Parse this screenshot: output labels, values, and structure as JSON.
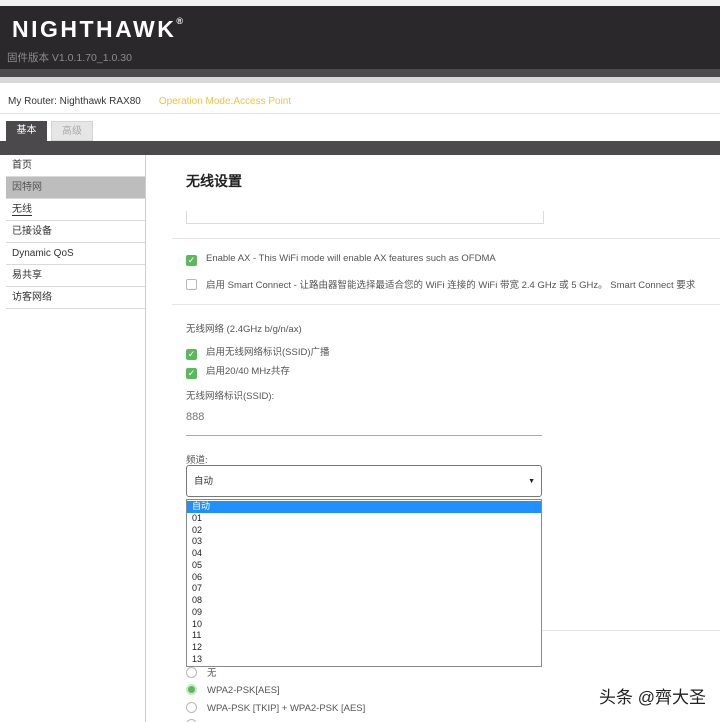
{
  "header": {
    "logo": "NIGHTHAWK",
    "logo_mark": "®",
    "firmware": "固件版本 V1.0.1.70_1.0.30"
  },
  "router_info": {
    "name": "My Router: Nighthawk RAX80",
    "mode": "Operation Mode:Access Point"
  },
  "tabs": [
    {
      "label": "基本",
      "active": true
    },
    {
      "label": "高级",
      "active": false
    }
  ],
  "sidebar": {
    "items": [
      {
        "label": "首页"
      },
      {
        "label": "因特网"
      },
      {
        "label": "无线"
      },
      {
        "label": "已接设备"
      },
      {
        "label": "Dynamic QoS"
      },
      {
        "label": "易共享"
      },
      {
        "label": "访客网络"
      }
    ]
  },
  "main": {
    "title": "无线设置",
    "enable_ax": {
      "label": "Enable AX - This WiFi mode will enable AX features such as OFDMA",
      "checked": true
    },
    "smart_connect": {
      "label": "启用 Smart Connect - 让路由器智能选择最适合您的 WiFi 连接的 WiFi 带宽 2.4 GHz 或 5 GHz。 Smart Connect 要求",
      "checked": false
    },
    "band_label": "无线网络 (2.4GHz b/g/n/ax)",
    "ssid_broadcast": {
      "label": "启用无线网络标识(SSID)广播",
      "checked": true
    },
    "coexist": {
      "label": "启用20/40 MHz共存",
      "checked": true
    },
    "ssid_label": "无线网络标识(SSID):",
    "ssid_value": "888",
    "channel_label": "频道:",
    "channel_selected": "自动",
    "channel_options": [
      "自动",
      "01",
      "02",
      "03",
      "04",
      "05",
      "06",
      "07",
      "08",
      "09",
      "10",
      "11",
      "12",
      "13"
    ],
    "security_options": [
      {
        "label": "无",
        "selected": false
      },
      {
        "label": "WPA2-PSK[AES]",
        "selected": true
      },
      {
        "label": "WPA-PSK [TKIP] + WPA2-PSK [AES]",
        "selected": false
      }
    ]
  },
  "watermark": "头条 @齊大圣",
  "colors": {
    "header_bg": "#2a282b",
    "nav_bg": "#4b494c",
    "mode_text": "#f1c244",
    "check_green": "#5cb85c",
    "dropdown_highlight": "#1e90ff"
  }
}
